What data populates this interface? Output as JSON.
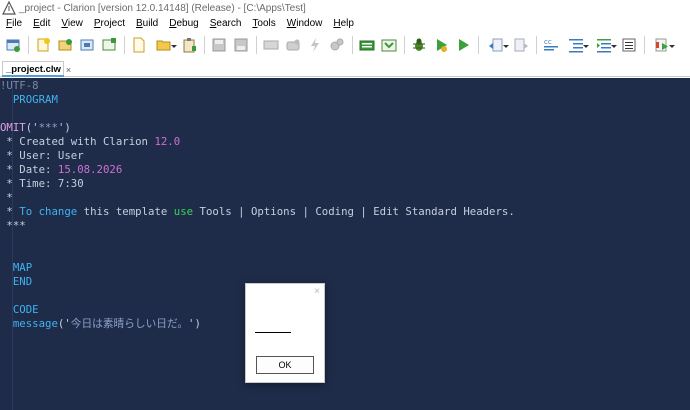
{
  "window": {
    "title": "_project - Clarion [version 12.0.14148] (Release) - [C:\\Apps\\Test]"
  },
  "menu": {
    "items": [
      {
        "first": "F",
        "rest": "ile"
      },
      {
        "first": "E",
        "rest": "dit"
      },
      {
        "first": "V",
        "rest": "iew"
      },
      {
        "first": "P",
        "rest": "roject"
      },
      {
        "first": "B",
        "rest": "uild"
      },
      {
        "first": "D",
        "rest": "ebug"
      },
      {
        "first": "S",
        "rest": "earch"
      },
      {
        "first": "T",
        "rest": "ools"
      },
      {
        "first": "W",
        "rest": "indow"
      },
      {
        "first": "H",
        "rest": "elp"
      }
    ]
  },
  "toolbar": {
    "icons": [
      "new-solution-icon",
      "new-project-icon",
      "new-item-icon",
      "open-project-icon",
      "add-item-icon",
      "new-file-icon",
      "open-file-icon",
      "paste-icon",
      "save-icon",
      "save-all-icon",
      "compile-icon",
      "build-icon",
      "lightning-icon",
      "gears-icon",
      "dictionary-icon",
      "app-gen-icon",
      "bug-debug-icon",
      "run-debug-icon",
      "run-icon",
      "navigate-back-icon",
      "navigate-forward-icon",
      "comment-icon",
      "indent-icon",
      "outdent-icon",
      "list-icon",
      "bookmark-icon"
    ]
  },
  "tab": {
    "label": "_project.clw",
    "close": "×"
  },
  "editor": {
    "lines": [
      [
        {
          "t": "!UTF-8",
          "c": "c-dim"
        }
      ],
      [
        {
          "t": "  PROGRAM",
          "c": "c-kw"
        }
      ],
      [
        {
          "t": "",
          "c": "c-cmt"
        }
      ],
      [
        {
          "t": "OMIT",
          "c": "c-omit"
        },
        {
          "t": "('",
          "c": "c-paren"
        },
        {
          "t": "***",
          "c": "c-str"
        },
        {
          "t": "')",
          "c": "c-paren"
        }
      ],
      [
        {
          "t": " * Created with Clarion ",
          "c": "c-cmt"
        },
        {
          "t": "12.0",
          "c": "c-num"
        }
      ],
      [
        {
          "t": " * User: User",
          "c": "c-cmt"
        }
      ],
      [
        {
          "t": " * Date: ",
          "c": "c-cmt"
        },
        {
          "t": "15.08.2026",
          "c": "c-num"
        }
      ],
      [
        {
          "t": " * Time: 7:30",
          "c": "c-cmt"
        }
      ],
      [
        {
          "t": " *",
          "c": "c-cmt"
        }
      ],
      [
        {
          "t": " * ",
          "c": "c-cmt"
        },
        {
          "t": "To change",
          "c": "c-kw"
        },
        {
          "t": " this template ",
          "c": "c-cmt"
        },
        {
          "t": "use",
          "c": "c-green"
        },
        {
          "t": " Tools | Options | Coding | Edit Standard Headers.",
          "c": "c-cmt"
        }
      ],
      [
        {
          "t": " ***",
          "c": "c-cmt"
        }
      ],
      [
        {
          "t": "",
          "c": "c-cmt"
        }
      ],
      [
        {
          "t": "",
          "c": "c-cmt"
        }
      ],
      [
        {
          "t": "  MAP",
          "c": "c-kw"
        }
      ],
      [
        {
          "t": "  END",
          "c": "c-kw"
        }
      ],
      [
        {
          "t": "",
          "c": "c-cmt"
        }
      ],
      [
        {
          "t": "  CODE",
          "c": "c-kw"
        }
      ],
      [
        {
          "t": "  message",
          "c": "c-kw"
        },
        {
          "t": "('",
          "c": "c-paren"
        },
        {
          "t": "今日は素晴らしい日だ。",
          "c": "c-str"
        },
        {
          "t": "')",
          "c": "c-paren"
        }
      ]
    ]
  },
  "dialog": {
    "close": "×",
    "message": "",
    "ok_label": "OK"
  }
}
